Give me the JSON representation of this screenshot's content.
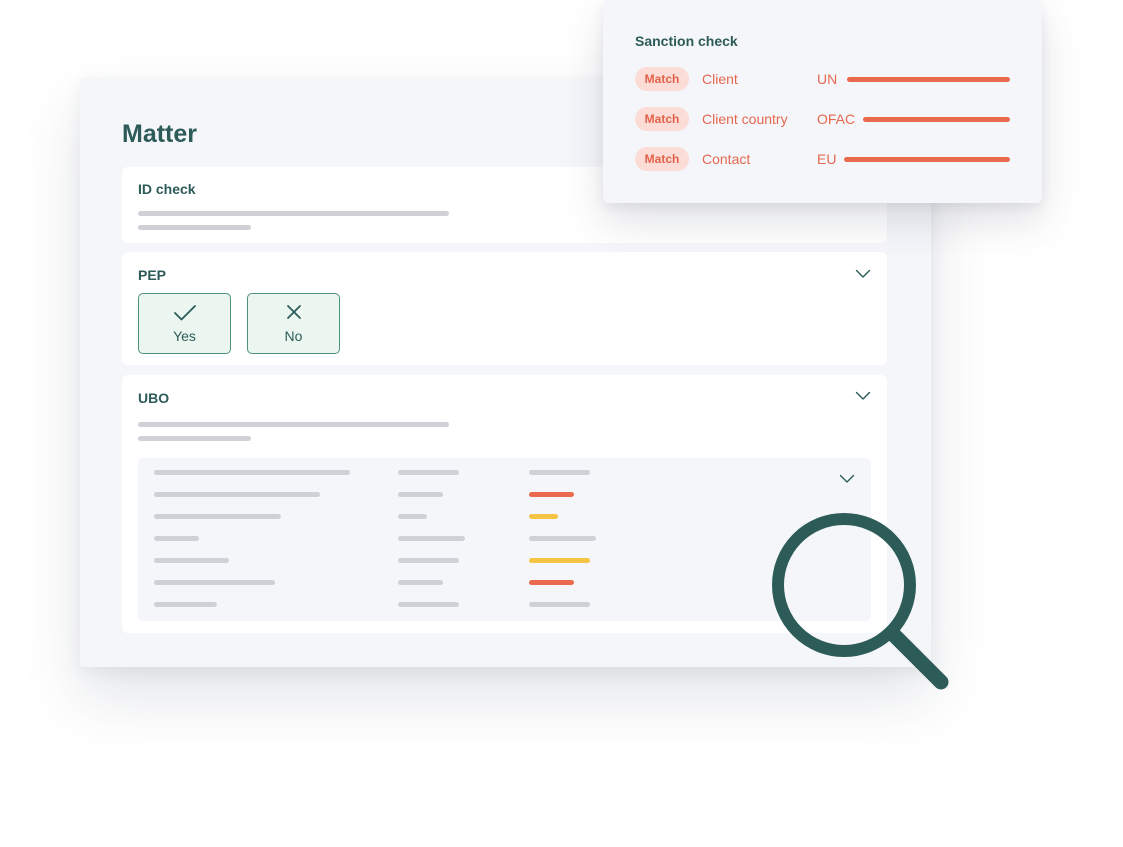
{
  "matter": {
    "title": "Matter",
    "sections": {
      "id_check": {
        "label": "ID check"
      },
      "pep": {
        "label": "PEP",
        "options": [
          {
            "label": "Yes",
            "icon": "check-icon"
          },
          {
            "label": "No",
            "icon": "close-icon"
          }
        ]
      },
      "ubo": {
        "label": "UBO"
      }
    },
    "table_status_colors": {
      "neutral": "#cfd1d6",
      "red": "#e96a4d",
      "yellow": "#f6c445"
    }
  },
  "sanction_check": {
    "title": "Sanction check",
    "rows": [
      {
        "status": "Match",
        "entity": "Client",
        "source": "UN"
      },
      {
        "status": "Match",
        "entity": "Client country",
        "source": "OFAC"
      },
      {
        "status": "Match",
        "entity": "Contact",
        "source": "EU"
      }
    ]
  },
  "colors": {
    "brand_teal": "#2d5b58",
    "alert_orange": "#e96a4d",
    "warning_yellow": "#f6c445"
  }
}
